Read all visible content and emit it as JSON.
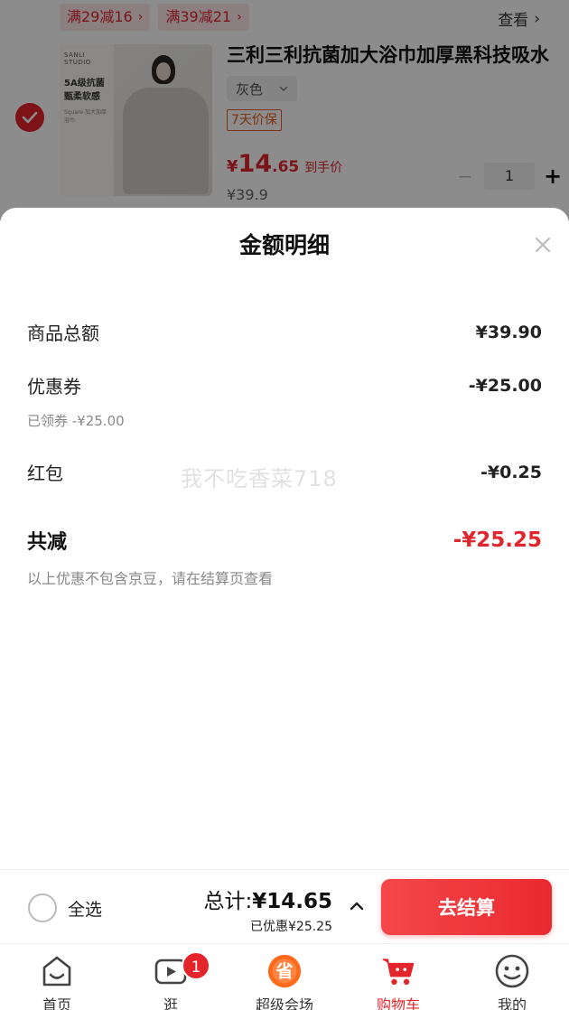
{
  "cart_item": {
    "promos": [
      {
        "label": "满29减16"
      },
      {
        "label": "满39减21"
      }
    ],
    "view_label": "查看",
    "image_brand": "SANLI STUDIO",
    "image_line1": "5A级抗菌",
    "image_line2": "甄柔软感",
    "image_line3": "Square 加大加厚浴巾",
    "title": "三利三利抗菌加大浴巾加厚黑科技吸水",
    "spec": "灰色",
    "price_protect": "7天价保",
    "price_yen": "¥",
    "price_int": "14",
    "price_dec": ".65",
    "price_tag": "到手价",
    "original_price": "¥39.9",
    "quantity": "1",
    "minus": "−",
    "plus": "+"
  },
  "sheet": {
    "title": "金额明细",
    "rows": {
      "subtotal": {
        "label": "商品总额",
        "value": "¥39.90"
      },
      "coupon": {
        "label": "优惠券",
        "value": "-¥25.00",
        "note": "已领券 -¥25.00"
      },
      "redpacket": {
        "label": "红包",
        "value": "-¥0.25"
      },
      "total_off": {
        "label": "共减",
        "value": "-¥25.25"
      }
    },
    "disclaimer": "以上优惠不包含京豆，请在结算页查看",
    "watermark": "我不吃香菜718"
  },
  "checkout": {
    "select_all": "全选",
    "total_label": "总计:",
    "total_value": "¥14.65",
    "saved": "已优惠¥25.25",
    "button": "去结算"
  },
  "tabbar": {
    "home": "首页",
    "browse": "逛",
    "browse_badge": "1",
    "venue": "超级会场",
    "venue_icon_char": "省",
    "cart": "购物车",
    "me": "我的"
  },
  "colors": {
    "accent": "#e0262e",
    "price_protect": "#e35c1f",
    "venue_orange": "#ff6a1a"
  }
}
